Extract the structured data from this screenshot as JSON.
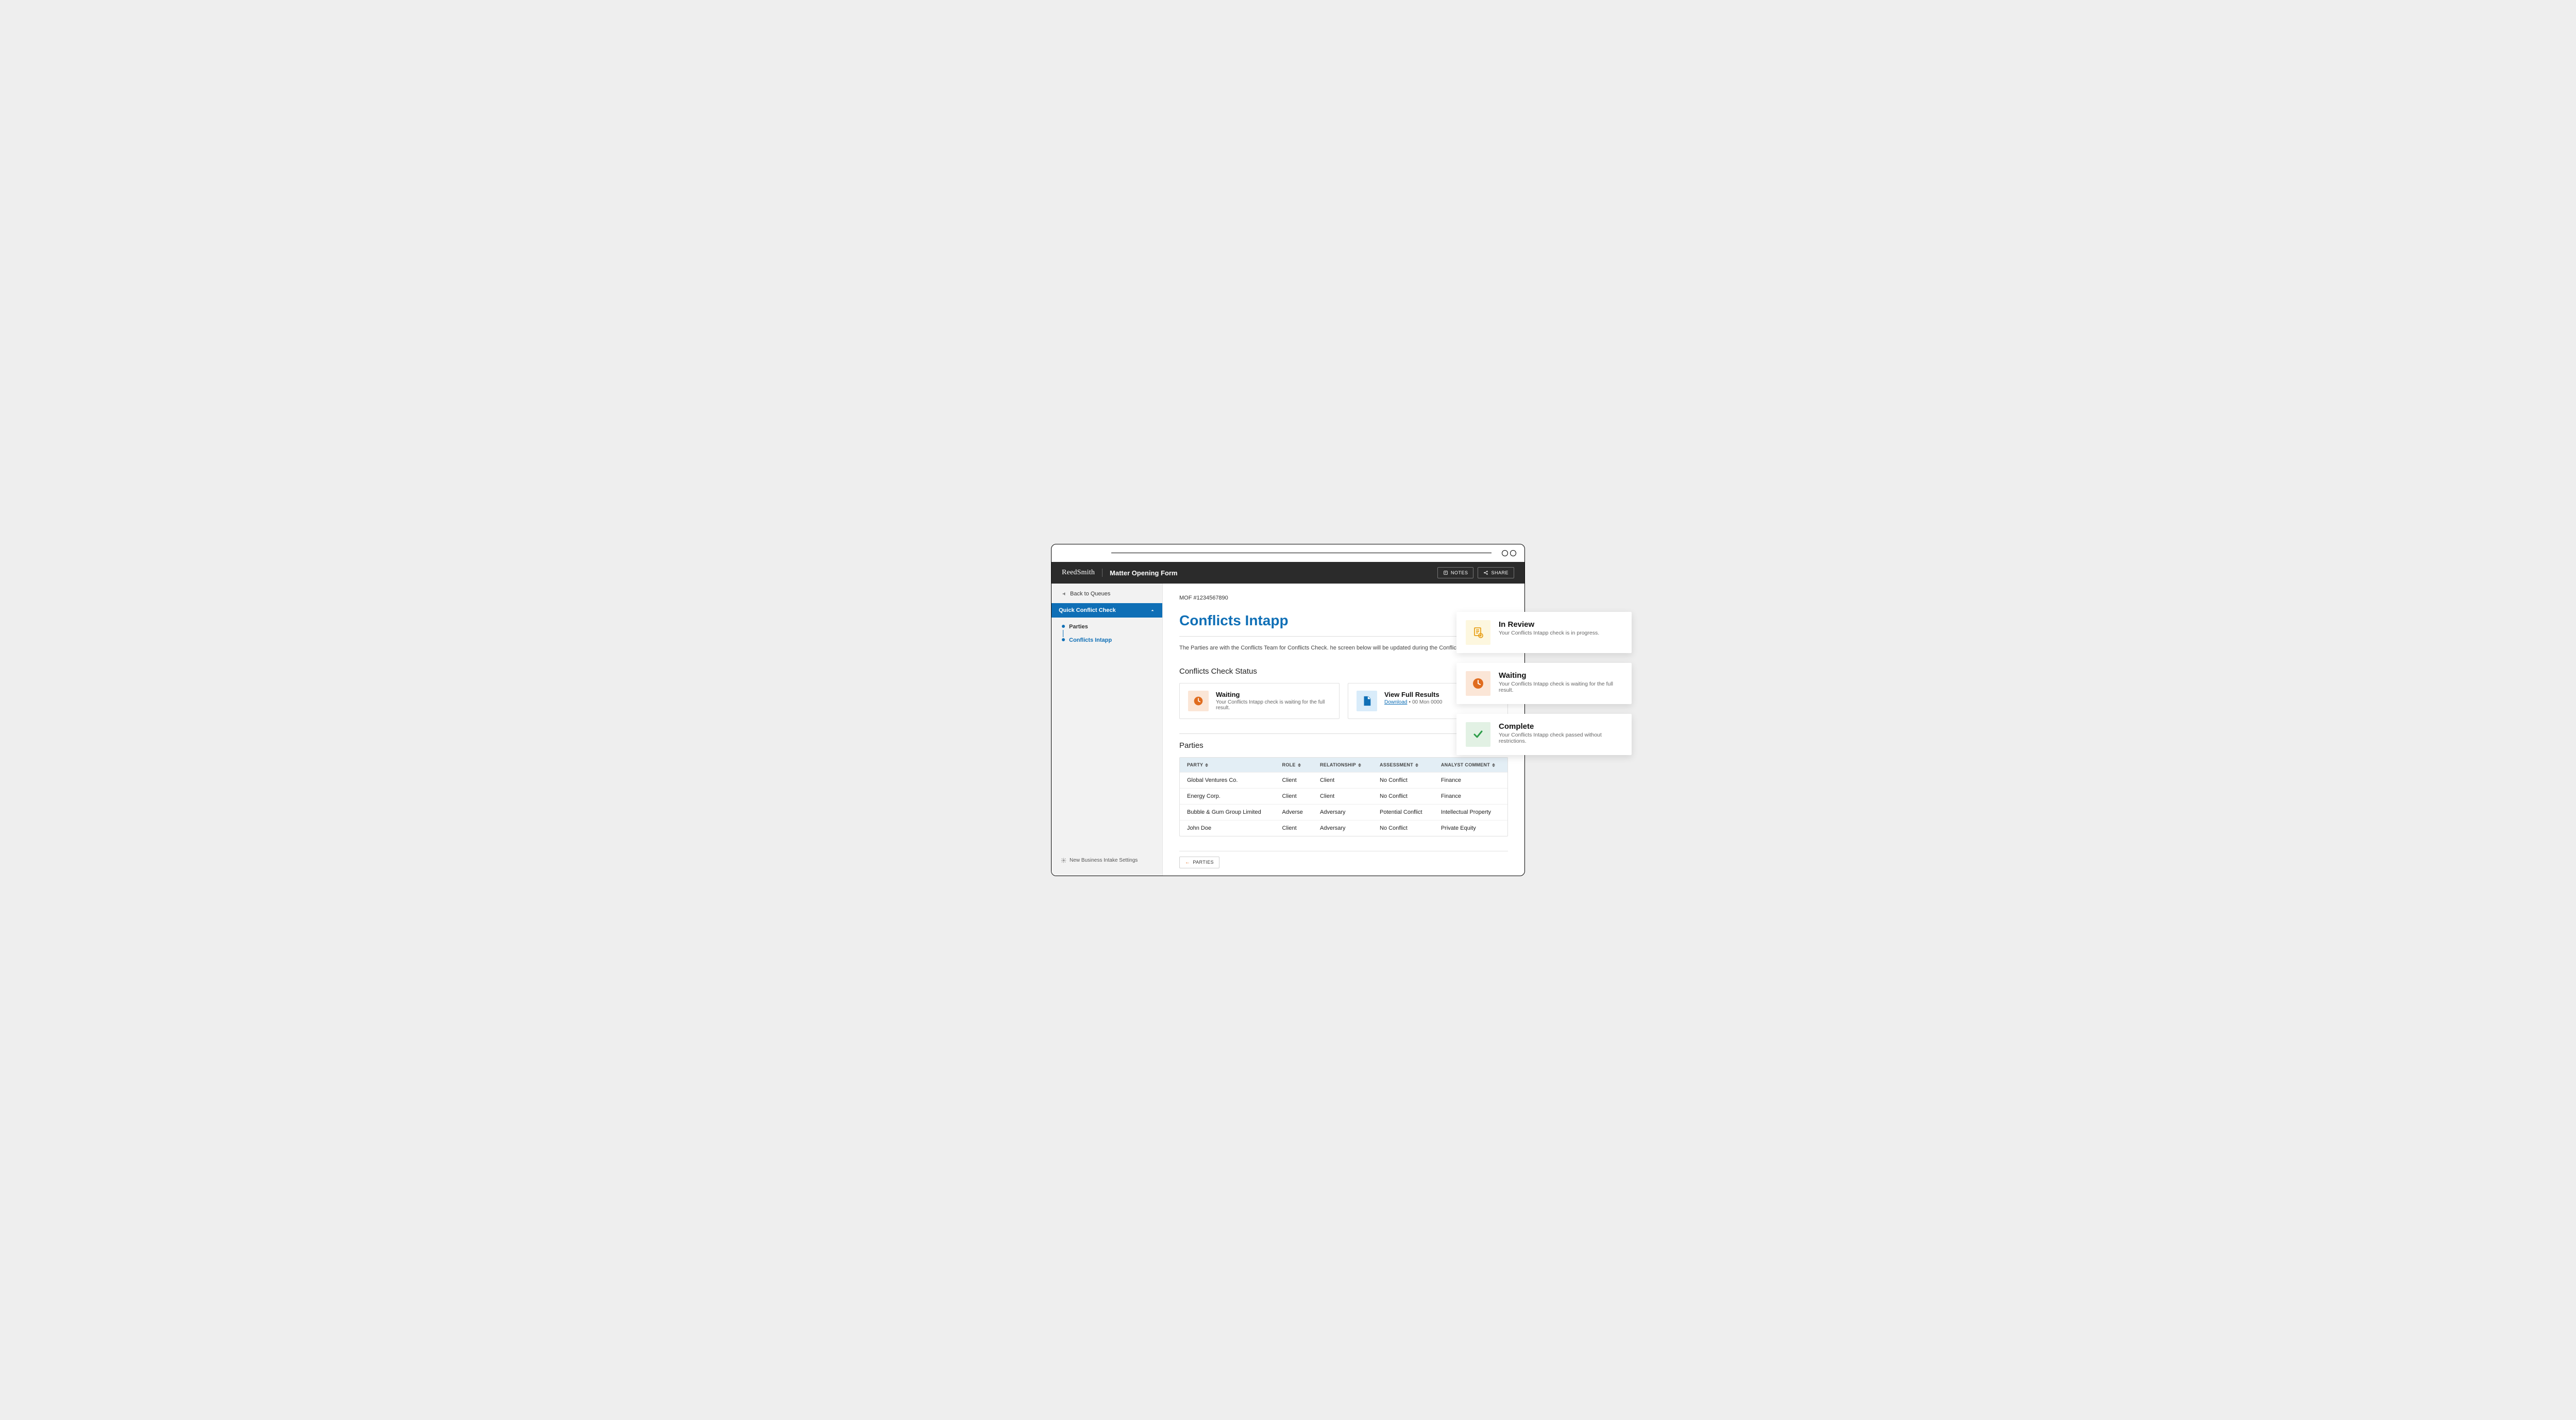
{
  "header": {
    "brand": "ReedSmith",
    "title": "Matter Opening Form",
    "notes_label": "NOTES",
    "share_label": "SHARE"
  },
  "sidebar": {
    "back_label": "Back to Queues",
    "section_label": "Quick Conflict Check",
    "items": [
      {
        "label": "Parties"
      },
      {
        "label": "Conflicts Intapp"
      }
    ],
    "footer_label": "New Business Intake Settings"
  },
  "main": {
    "mof_id": "MOF #1234567890",
    "title": "Conflicts Intapp",
    "intro": "The Parties are with the Conflicts Team for Conflicts Check. he screen below will be updated during the Conflict checking process.",
    "status_heading": "Conflicts Check Status",
    "waiting": {
      "title": "Waiting",
      "subtitle": "Your Conflicts Intapp check is waiting for the full result."
    },
    "results": {
      "title": "View Full Results",
      "download_label": "Download",
      "date": "00 Mon 0000"
    },
    "parties_heading": "Parties",
    "parties_button": "PARTIES"
  },
  "table": {
    "columns": [
      "PARTY",
      "ROLE",
      "RELATIONSHIP",
      "ASSESSMENT",
      "ANALYST COMMENT"
    ],
    "rows": [
      {
        "party": "Global Ventures Co.",
        "role": "Client",
        "relationship": "Client",
        "assessment": "No Conflict",
        "comment": "Finance"
      },
      {
        "party": "Energy Corp.",
        "role": "Client",
        "relationship": "Client",
        "assessment": "No Conflict",
        "comment": "Finance"
      },
      {
        "party": "Bubble & Gum Group Limited",
        "role": "Adverse",
        "relationship": "Adversary",
        "assessment": "Potential Conflict",
        "comment": "Intellectual Property"
      },
      {
        "party": "John Doe",
        "role": "Client",
        "relationship": "Adversary",
        "assessment": "No Conflict",
        "comment": "Private Equity"
      }
    ]
  },
  "float_cards": [
    {
      "title": "In Review",
      "subtitle": "Your Conflicts Intapp check is in progress."
    },
    {
      "title": "Waiting",
      "subtitle": "Your Conflicts Intapp check is waiting for the full result."
    },
    {
      "title": "Complete",
      "subtitle": "Your Conflicts Intapp check passed without restrictions."
    }
  ]
}
